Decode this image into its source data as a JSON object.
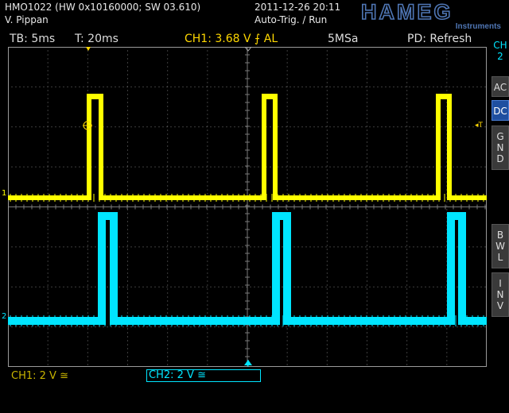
{
  "header": {
    "model_line": "HMO1022 (HW 0x10160000; SW 03.610)",
    "author": "V. Pippan",
    "datetime": "2011-12-26 20:11",
    "trigger_state": "Auto-Trig. / Run",
    "logo_text": "HAMEG",
    "logo_subtext": "Instruments"
  },
  "status": {
    "timebase": "TB: 5ms",
    "trigger_time": "T: 20ms",
    "trigger_info": "CH1: 3.68 V ⨍ AL",
    "sample_rate": "5MSa",
    "peak_detect": "PD: Refresh"
  },
  "side_menu": {
    "channel_label": "CH\n2",
    "buttons": [
      "AC",
      "DC",
      "G\nN\nD",
      "B\nW\nL",
      "I\nN\nV"
    ],
    "selected": "DC"
  },
  "markers": {
    "ch1_marker": "1",
    "ch2_marker": "2",
    "trigger_marker": "◂T"
  },
  "bottom": {
    "ch1_scale": "CH1: 2 V ≅",
    "ch2_scale": "CH2: 2 V ≅"
  },
  "colors": {
    "ch1": "#ffff00",
    "ch2": "#00e5ff",
    "accent_text": "#ffd800",
    "selected_button": "#1f4fa0",
    "grid": "#7a7a7a"
  }
}
